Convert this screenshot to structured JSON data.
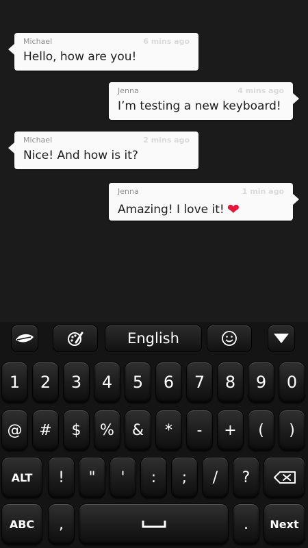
{
  "messages": [
    {
      "sender": "Michael",
      "time": "6 mins ago",
      "text": "Hello, how are you!"
    },
    {
      "sender": "Jenna",
      "time": "4 mins ago",
      "text": "I’m testing a new keyboard!"
    },
    {
      "sender": "Michael",
      "time": "2 mins ago",
      "text": "Nice! And how is it?"
    },
    {
      "sender": "Jenna",
      "time": "1 min ago",
      "text": "Amazing! I love it!"
    }
  ],
  "heart_glyph": "❤",
  "toolbar": {
    "language": "English"
  },
  "keyboard": {
    "row1": [
      "1",
      "2",
      "3",
      "4",
      "5",
      "6",
      "7",
      "8",
      "9",
      "0"
    ],
    "row2": [
      "@",
      "#",
      "$",
      "%",
      "&",
      "*",
      "-",
      "+",
      "(",
      ")"
    ],
    "row3": {
      "alt": "ALT",
      "keys": [
        "!",
        "\"",
        "'",
        ":",
        ";",
        "/",
        "?"
      ]
    },
    "row4": {
      "abc": "ABC",
      "comma": ",",
      "period": ".",
      "next": "Next"
    }
  },
  "colors": {
    "accent_heart": "#e8153a",
    "bubble": "#fafafa",
    "background": "#1c1b1b"
  }
}
